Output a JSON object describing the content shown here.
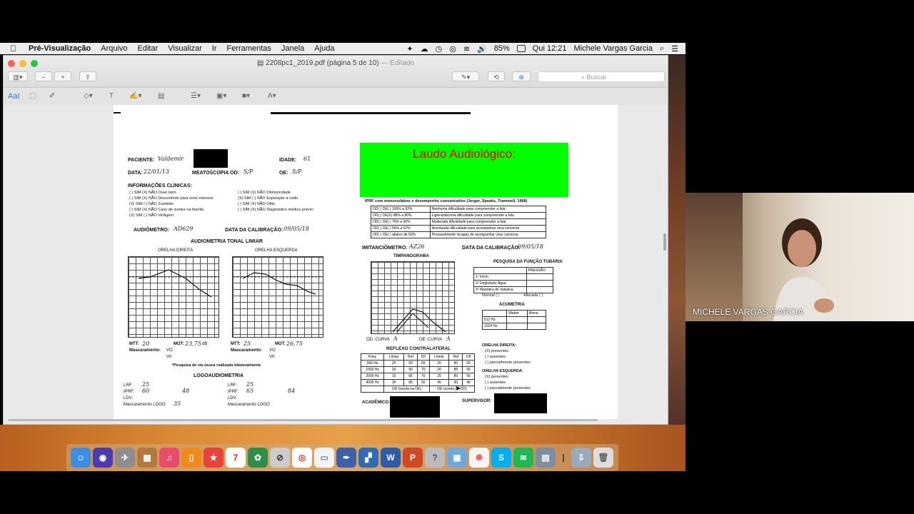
{
  "menubar": {
    "apple": "",
    "app_name": "Pré-Visualização",
    "items": [
      "Arquivo",
      "Editar",
      "Visualizar",
      "Ir",
      "Ferramentas",
      "Janela",
      "Ajuda"
    ],
    "battery": "85%",
    "clock": "Qui 12:21",
    "user": "Michele Vargas Garcia"
  },
  "window": {
    "title": "2208pc1_2019.pdf (página 5 de 10)",
    "edited": " — Editado",
    "search_placeholder": "Buscar",
    "markup_label": "AaI"
  },
  "document": {
    "paciente_label": "PACIENTE:",
    "paciente_value": "Valdemir",
    "idade_label": "IDADE:",
    "idade_value": "61",
    "data_label": "DATA:",
    "data_value": "22/01/13",
    "meatoscopia_label": "MEATOSCOPIA OD:",
    "meatoscopia_od": "S/P",
    "oe_label": "OE:",
    "oe_value": "S/P",
    "info_clinicas": "INFORMAÇÕES CLÍNICAS:",
    "clin_left": [
      "( ) SIM (X) NÃO  Ouve bem",
      "( ) SIM (X) NÃO  Desconforto para sons intensos",
      "(X) SIM ( ) NÃO  Zumbido",
      "( ) SIM (X) NÃO  Caso de surdez na família",
      "(X) SIM ( ) NÃO  Vertigem"
    ],
    "clin_right": [
      "( ) SIM (X) NÃO  Ototoxicidade",
      "(X) SIM ( ) NÃO  Exposição a ruído",
      "( ) SIM (X) NÃO  Otite",
      "( ) SIM (X) NÃO  Diagnóstico médico prévio:"
    ],
    "audiometro_label": "AUDIÔMETRO:",
    "audiometro_value": "AD629",
    "calib_label": "DATA DA CALIBRAÇÃO:",
    "calib_value": "09/05/18",
    "audiometria_title": "AUDIOMETRIA TONAL LIMIAR",
    "orelha_direita": "ORELHA DIREITA",
    "orelha_esquerda": "ORELHA ESQUERDA",
    "mtt_label": "MTT:",
    "mtt_od": "20",
    "mtt_oe": "25",
    "mot_label": "MOT:",
    "mot_od": "23,75",
    "mot_oe": "26,75",
    "db": "dB",
    "mascaramento": "Mascaramento:",
    "vo": "VO",
    "va": "VA",
    "pesquisa_note": "*Pesquisa de via óssea realizada bilateralmente",
    "logo_title": "LOGOAUDIOMETRIA",
    "lrf": "LRF:",
    "iprf": "IPRF:",
    "ldv": "LDV:",
    "masc_logo": "Mascaramento LOGO",
    "lrf_od": "25",
    "iprf_od": "60",
    "iprf_od_pct": "48",
    "masc_logo_od": "35",
    "lrf_oe": "25",
    "iprf_oe": "65",
    "iprf_oe_pct": "84",
    "laudo": "Laudo Audiológico:",
    "iprf_title": "IPRF com monossílabos x desempenho comunicativo (Jerger, Speaks, Trammell, 1968)",
    "iprf_rows": [
      [
        "OD( ) OE( )  100% a 92%",
        "Nenhuma dificuldade para compreender a fala"
      ],
      [
        "OD( ) OE(X)  88% a 80%",
        "Ligeira/discreta dificuldade para compreender a fala"
      ],
      [
        "OD( ) OE( )  76% a 60%",
        "Moderada dificuldade para compreender a fala"
      ],
      [
        "OD( ) OE( )  56% a 52%",
        "Acentuada dificuldade para acompanhar uma conversa"
      ],
      [
        "OD( ) OE( )  abaixo de 50%",
        "Provavelmente incapaz de acompanhar uma conversa"
      ]
    ],
    "imitanciometro_label": "IMITANCIÔMETRO:",
    "imitanciometro_value": "AZ26",
    "calib2_value": "09/05/18",
    "timpanograma": "TIMPANOGRAMA",
    "funcao_tubaria": "PESQUISA DA FUNÇÃO TUBÁRIA",
    "pressao": "PRESSÃO",
    "ft_rows": [
      "1º Início",
      "2º Deglutição Água",
      "3º Manobra de Valsalva"
    ],
    "normal": "Normal ( )",
    "alterada": "Alterada ( )",
    "acumetria": "ACUMETRIA",
    "weber": "Weber",
    "rinne": "Rinne",
    "hz512": "512 Hz",
    "hz1024": "1024 Hz",
    "od_curva": "OD: CURVA",
    "od_curva_v": "A",
    "oe_curva": "OE: CURVA",
    "oe_curva_v": "A",
    "reflexo_title": "REFLEXO CONTRALATERAL",
    "reflexo_head": [
      "Freq.",
      "Limiar",
      "Ref",
      "Dif",
      "Limiar",
      "Ref",
      "Dif"
    ],
    "reflexo_rows": [
      [
        "500 Hz",
        "25",
        "90",
        "65",
        "20",
        "80",
        "60"
      ],
      [
        "1000 Hz",
        "20",
        "90",
        "70",
        "20",
        "85",
        "65"
      ],
      [
        "2000 Hz",
        "15",
        "85",
        "70",
        "25",
        "80",
        "55"
      ],
      [
        "4000 Hz",
        "35",
        "85",
        "50",
        "45",
        "90",
        "40"
      ]
    ],
    "reflexo_foot_od": "OD (sonda na OE)",
    "reflexo_foot_oe": "OE (sonda na OD)",
    "orelha_dir_label": "ORELHA DIREITA:",
    "orelha_esq_label": "ORELHA ESQUERDA:",
    "ref_opts": [
      "(X) presentes",
      "( ) ausentes",
      "( ) parcialmente presentes"
    ],
    "academico": "ACADÊMICO:",
    "supervisor": "SUPERVISOR:"
  },
  "video": {
    "participant_name": "MICHELE VARGAS GARCIA"
  }
}
